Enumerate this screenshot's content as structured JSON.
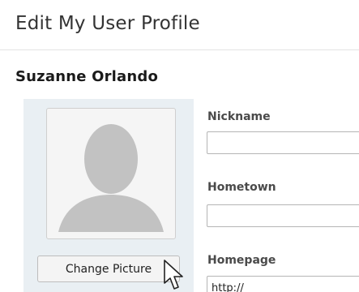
{
  "page": {
    "title": "Edit My User Profile"
  },
  "profile": {
    "name": "Suzanne Orlando",
    "change_picture_label": "Change Picture"
  },
  "fields": {
    "nickname": {
      "label": "Nickname",
      "value": ""
    },
    "hometown": {
      "label": "Hometown",
      "value": ""
    },
    "homepage": {
      "label": "Homepage",
      "value": "http://"
    }
  },
  "icons": {
    "avatar": "default-user-silhouette-icon",
    "cursor": "mouse-pointer-icon"
  },
  "colors": {
    "panel_background": "#e9eff3",
    "avatar_silhouette": "#c2c2c2"
  }
}
